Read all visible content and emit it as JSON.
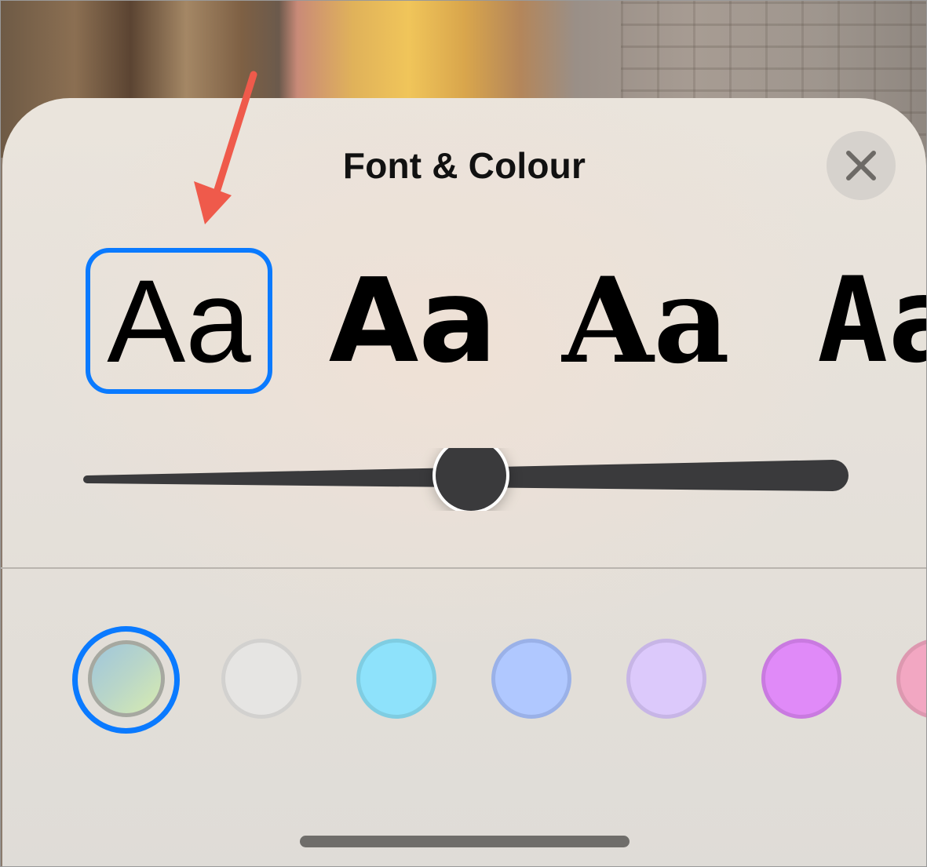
{
  "sheet": {
    "title": "Font & Colour",
    "close_icon": "close-x-icon"
  },
  "fonts": [
    {
      "label": "Aa",
      "style": "sans",
      "selected": true
    },
    {
      "label": "Aa",
      "style": "rounded-sans",
      "selected": false
    },
    {
      "label": "Aa",
      "style": "serif",
      "selected": false
    },
    {
      "label": "Aa",
      "style": "condensed",
      "selected": false
    }
  ],
  "weight_slider": {
    "value": 0.5
  },
  "colors": [
    {
      "name": "gradient",
      "fill": "#b6d9c6",
      "border": "#a6a8a0",
      "selected": true
    },
    {
      "name": "light-gray",
      "fill": "#e6e5e3",
      "border": "#d2d1cf",
      "selected": false
    },
    {
      "name": "cyan",
      "fill": "#8ee2fb",
      "border": "#7fcde2",
      "selected": false
    },
    {
      "name": "blue",
      "fill": "#b0c8ff",
      "border": "#9ab1e8",
      "selected": false
    },
    {
      "name": "lavender",
      "fill": "#dcc9fb",
      "border": "#c7b5e6",
      "selected": false
    },
    {
      "name": "purple",
      "fill": "#e08af8",
      "border": "#c97ae0",
      "selected": false
    },
    {
      "name": "pink",
      "fill": "#f2a7c2",
      "border": "#dd98b0",
      "selected": false
    }
  ],
  "accent_color": "#0a7aff",
  "annotation_arrow_color": "#ef5a4b"
}
